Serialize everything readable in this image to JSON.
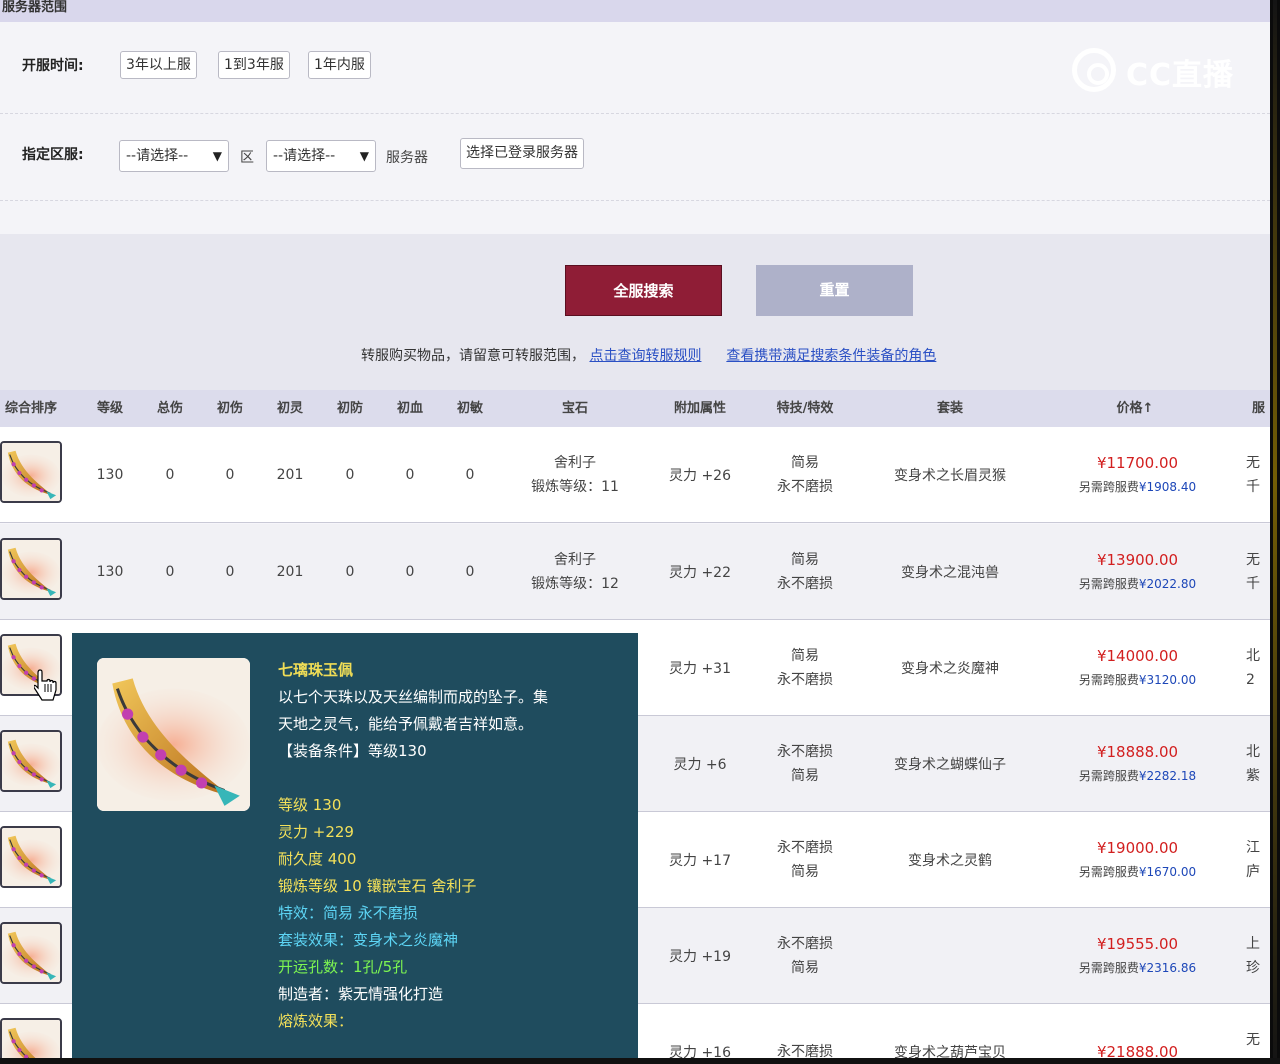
{
  "section_title": "服务器范围",
  "filters": {
    "open_time_label": "开服时间:",
    "open_time_options": [
      "3年以上服",
      "1到3年服",
      "1年内服"
    ],
    "zone_label": "指定区服:",
    "area_select": "--请选择--",
    "area_unit": "区",
    "server_select": "--请选择--",
    "server_unit": "服务器",
    "logged_button": "选择已登录服务器"
  },
  "watermark": "CC直播",
  "actions": {
    "search": "全服搜索",
    "reset": "重置",
    "notice": "转服购买物品，请留意可转服范围，",
    "link_rules": "点击查询转服规则",
    "link_roles": "查看携带满足搜索条件装备的角色"
  },
  "table": {
    "headers": [
      "综合排序",
      "等级",
      "总伤",
      "初伤",
      "初灵",
      "初防",
      "初血",
      "初敏",
      "宝石",
      "附加属性",
      "特技/特效",
      "套装",
      "价格↑",
      "服"
    ],
    "rows": [
      {
        "level": "130",
        "zongshang": "0",
        "chushang": "0",
        "chuling": "201",
        "chufang": "0",
        "chuxue": "0",
        "chumin": "0",
        "gem": "舍利子",
        "gem_level": "锻炼等级：11",
        "attr": "灵力 +26",
        "effect1": "简易",
        "effect2": "永不磨损",
        "suit": "变身术之长眉灵猴",
        "price": "¥11700.00",
        "fee_label": "另需跨服费",
        "fee": "¥1908.40",
        "server1": "无",
        "server2": "千"
      },
      {
        "level": "130",
        "zongshang": "0",
        "chushang": "0",
        "chuling": "201",
        "chufang": "0",
        "chuxue": "0",
        "chumin": "0",
        "gem": "舍利子",
        "gem_level": "锻炼等级：12",
        "attr": "灵力 +22",
        "effect1": "简易",
        "effect2": "永不磨损",
        "suit": "变身术之混沌兽",
        "price": "¥13900.00",
        "fee_label": "另需跨服费",
        "fee": "¥2022.80",
        "server1": "无",
        "server2": "千"
      },
      {
        "attr": "灵力 +31",
        "effect1": "简易",
        "effect2": "永不磨损",
        "suit": "变身术之炎魔神",
        "price": "¥14000.00",
        "fee_label": "另需跨服费",
        "fee": "¥3120.00",
        "server1": "北",
        "server2": "2"
      },
      {
        "attr": "灵力 +6",
        "effect1": "永不磨损",
        "effect2": "简易",
        "suit": "变身术之蝴蝶仙子",
        "price": "¥18888.00",
        "fee_label": "另需跨服费",
        "fee": "¥2282.18",
        "server1": "北",
        "server2": "紫"
      },
      {
        "attr": "灵力 +17",
        "effect1": "永不磨损",
        "effect2": "简易",
        "suit": "变身术之灵鹤",
        "price": "¥19000.00",
        "fee_label": "另需跨服费",
        "fee": "¥1670.00",
        "server1": "江",
        "server2": "庐"
      },
      {
        "attr": "灵力 +19",
        "effect1": "永不磨损",
        "effect2": "简易",
        "suit": "",
        "price": "¥19555.00",
        "fee_label": "另需跨服费",
        "fee": "¥2316.86",
        "server1": "上",
        "server2": "珍"
      },
      {
        "attr": "灵力 +16",
        "effect1": "永不磨损",
        "effect2": "",
        "suit": "变身术之葫芦宝贝",
        "price": "¥21888.00",
        "fee_label": "",
        "fee": "",
        "server1": "无",
        "server2": ""
      }
    ]
  },
  "tooltip": {
    "name": "七璃珠玉佩",
    "desc1": "以七个天珠以及天丝编制而成的坠子。集",
    "desc2": "天地之灵气，能给予佩戴者吉祥如意。",
    "requirement": "【装备条件】等级130",
    "level": "等级 130",
    "lingli": "灵力 +229",
    "durability": "耐久度 400",
    "forge": "锻炼等级 10 镶嵌宝石 舍利子",
    "effect": "特效：简易 永不磨损",
    "suit": "套装效果：变身术之炎魔神",
    "holes": "开运孔数：1孔/5孔",
    "maker": "制造者：紫无情强化打造",
    "smelt": "熔炼效果："
  },
  "colors": {
    "search_button": "#8f1d36",
    "reset_button": "#aeb1c9",
    "price": "#d21f1f",
    "fee": "#1d47b8",
    "tooltip_bg": "#1f4c5e"
  },
  "icons": {
    "item_thumbnail": "jade-pendant-icon",
    "cursor": "hand-cursor-icon"
  }
}
